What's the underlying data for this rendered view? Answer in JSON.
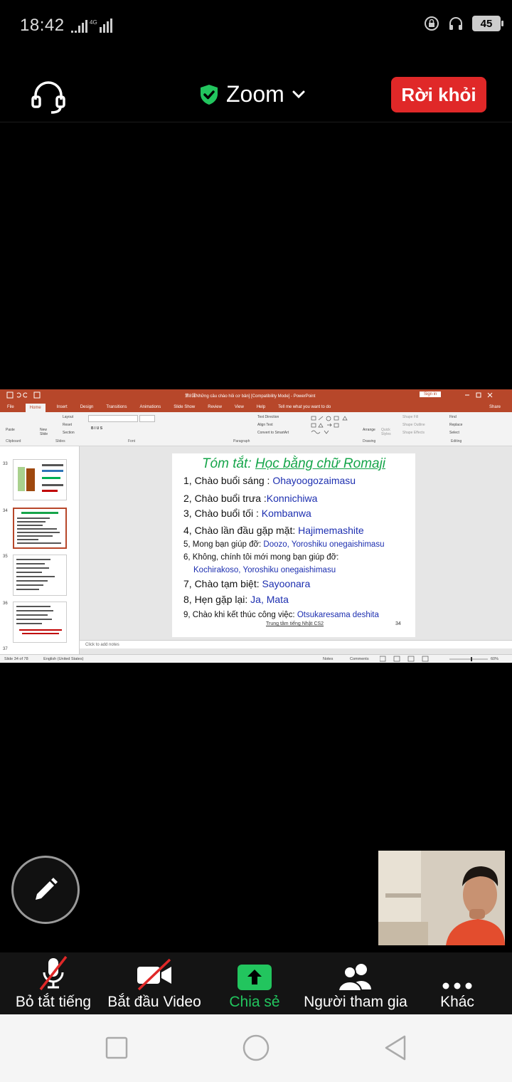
{
  "status_bar": {
    "time": "18:42",
    "network": "4G",
    "battery": "45"
  },
  "header": {
    "title": "Zoom",
    "leave_label": "Rời khỏi",
    "colors": {
      "leave": "#e02828",
      "shield": "#22c55e"
    }
  },
  "shared_screen": {
    "window_title": "第8课Những câu chào hỏi cơ bản] [Compatibility Mode] - PowerPoint",
    "signin_label": "Sign in",
    "share_label": "Share",
    "tabs": [
      "File",
      "Home",
      "Insert",
      "Design",
      "Transitions",
      "Animations",
      "Slide Show",
      "Review",
      "View",
      "Help",
      "Tell me what you want to do"
    ],
    "active_tab": "Home",
    "ribbon_groups": [
      "Clipboard",
      "Slides",
      "Font",
      "Paragraph",
      "Drawing",
      "Editing"
    ],
    "ribbon_items": {
      "paste": "Paste",
      "new_slide": "New Slide",
      "layout": "Layout",
      "reset": "Reset",
      "section": "Section",
      "text_direction": "Text Direction",
      "align_text": "Align Text",
      "smartart": "Convert to SmartArt",
      "arrange": "Arrange",
      "quick_styles": "Quick Styles",
      "shape_fill": "Shape Fill",
      "shape_outline": "Shape Outline",
      "shape_effects": "Shape Effects",
      "find": "Find",
      "replace": "Replace",
      "select": "Select"
    },
    "thumbnail_numbers": [
      "33",
      "34",
      "35",
      "36",
      "37"
    ],
    "slide": {
      "title_prefix": "Tóm tắt: ",
      "title_main": "Học bằng chữ Romaji",
      "lines": [
        {
          "text": "1, Chào buổi sáng : ",
          "jp": "Ohayoogozaimasu"
        },
        {
          "text": "2, Chào buổi trưa :",
          "jp": "Konnichiwa"
        },
        {
          "text": "3, Chào buổi tối : ",
          "jp": "Kombanwa"
        },
        {
          "text": "4, Chào lần đầu gặp mặt: ",
          "jp": "Hajimemashite"
        },
        {
          "text": "5, Mong bạn giúp đỡ: ",
          "jp": "Doozo, Yoroshiku onegaishimasu"
        },
        {
          "text": "6, Không, chính tôi mới mong bạn giúp đỡ:",
          "jp": ""
        },
        {
          "text": "",
          "jp": "Kochirakoso, Yoroshiku onegaishimasu"
        },
        {
          "text": "7, Chào tạm biệt: ",
          "jp": "Sayoonara"
        },
        {
          "text": "8, Hẹn gặp lại: ",
          "jp": "Ja, Mata"
        },
        {
          "text": "9, Chào khi kết thúc công việc: ",
          "jp": "Otsukaresama deshita"
        }
      ],
      "footer_center": "Trung tâm tiếng Nhật CS2",
      "footer_page": "34"
    },
    "notes_placeholder": "Click to add notes",
    "status_left": "Slide 34 of 78",
    "status_lang": "English (United States)",
    "status_notes": "Notes",
    "status_comments": "Comments",
    "zoom_level": "60%"
  },
  "toolbar": {
    "items": [
      {
        "label": "Bỏ tắt tiếng",
        "icon": "mic-muted-icon"
      },
      {
        "label": "Bắt đầu Video",
        "icon": "video-off-icon"
      },
      {
        "label": "Chia sẻ",
        "icon": "share-icon"
      },
      {
        "label": "Người tham gia",
        "icon": "participants-icon"
      },
      {
        "label": "Khác",
        "icon": "more-icon"
      }
    ]
  }
}
